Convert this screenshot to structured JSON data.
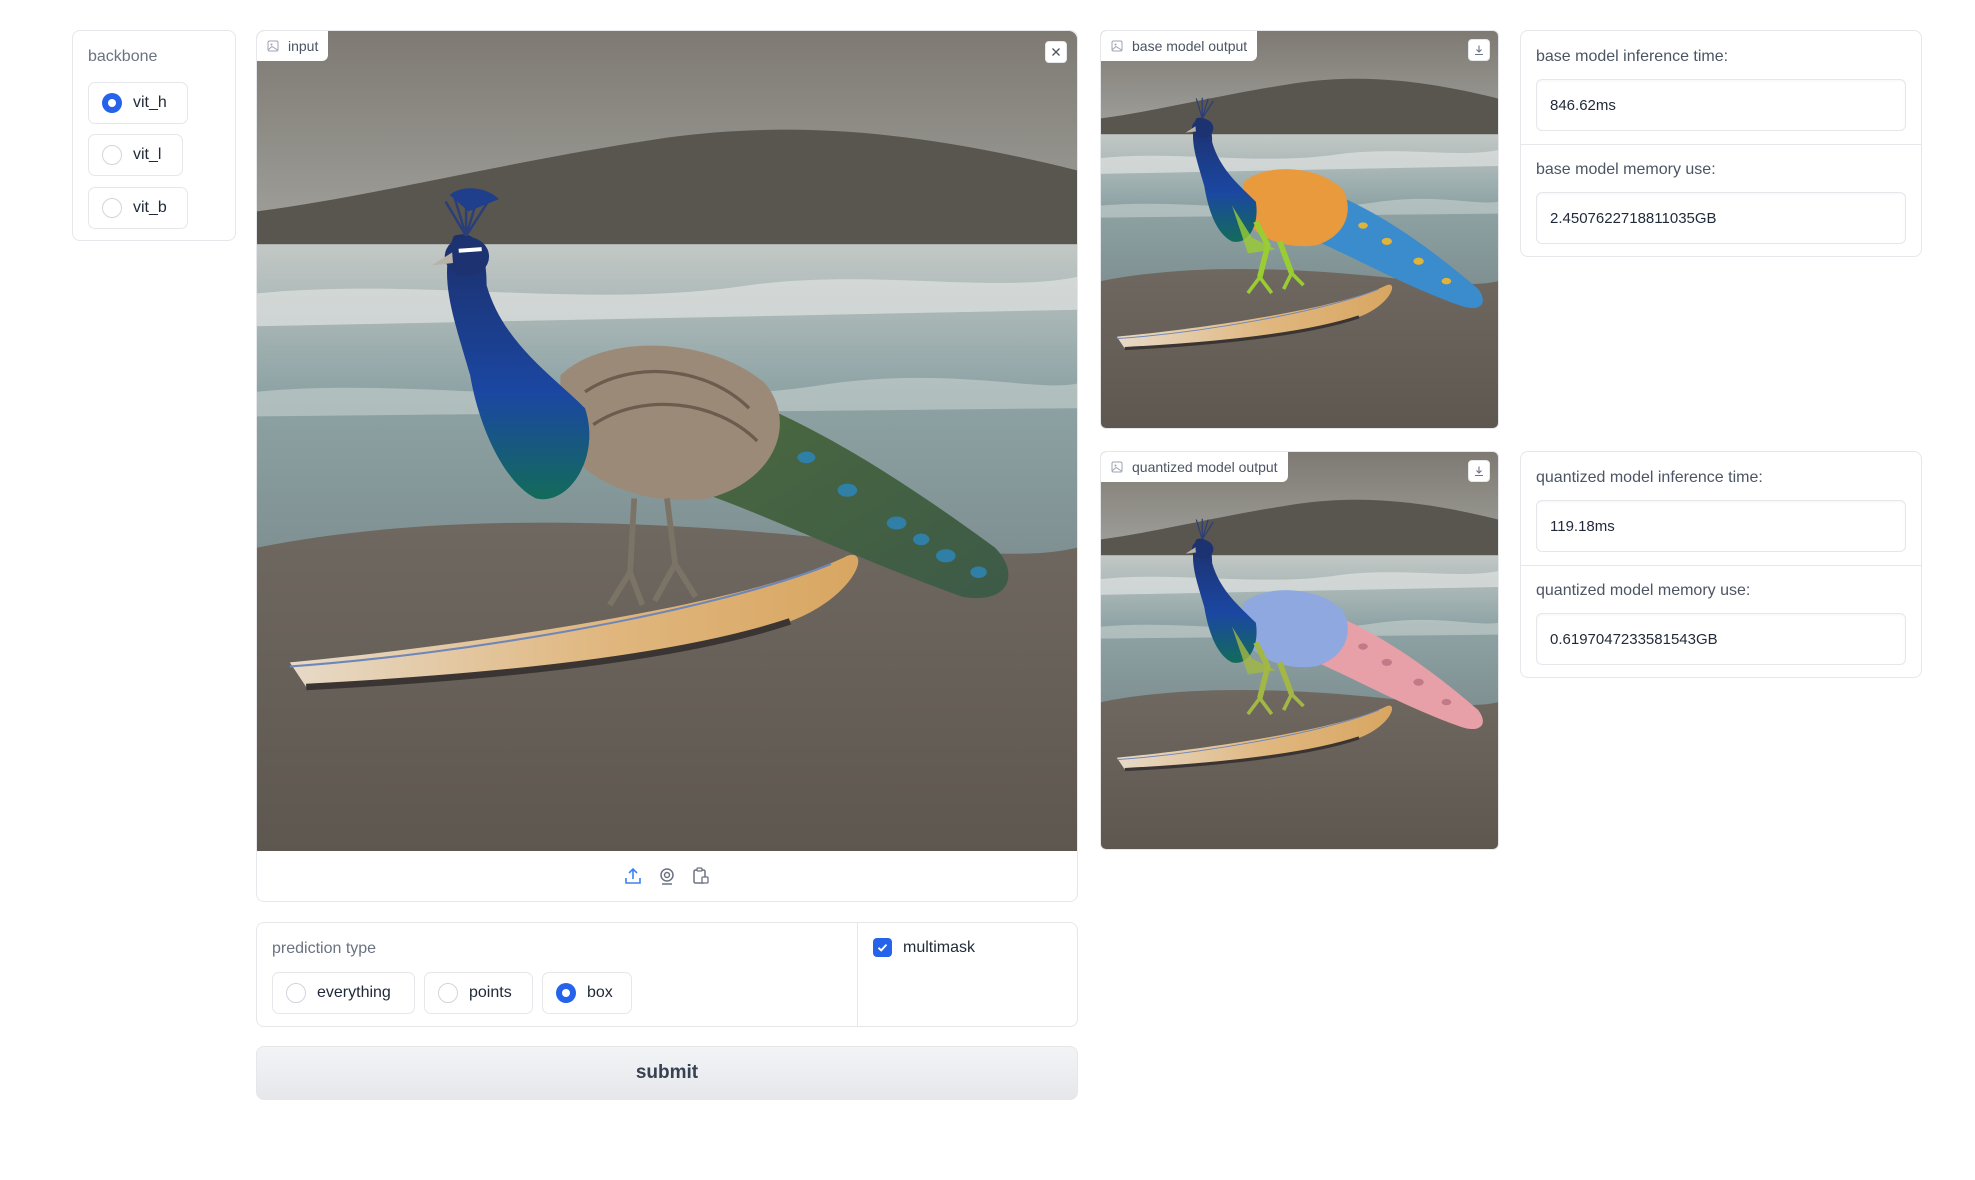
{
  "backbone": {
    "label": "backbone",
    "options": [
      {
        "label": "vit_h",
        "selected": true
      },
      {
        "label": "vit_l",
        "selected": false
      },
      {
        "label": "vit_b",
        "selected": false
      }
    ]
  },
  "input_image": {
    "label": "input",
    "close_icon": "close-icon",
    "toolbar_icons": [
      "upload-icon",
      "webcam-icon",
      "clipboard-icon"
    ]
  },
  "base_output": {
    "label": "base model output",
    "download_icon": "download-icon"
  },
  "quantized_output": {
    "label": "quantized model output",
    "download_icon": "download-icon"
  },
  "base_stats": {
    "time_label": "base model inference time:",
    "time_value": "846.62ms",
    "memory_label": "base model memory use:",
    "memory_value": "2.4507622718811035GB"
  },
  "quantized_stats": {
    "time_label": "quantized model inference time:",
    "time_value": "119.18ms",
    "memory_label": "quantized model memory use:",
    "memory_value": "0.6197047233581543GB"
  },
  "prediction_type": {
    "label": "prediction type",
    "options": [
      {
        "label": "everything",
        "selected": false
      },
      {
        "label": "points",
        "selected": false
      },
      {
        "label": "box",
        "selected": true
      }
    ]
  },
  "multimask": {
    "label": "multimask",
    "checked": true
  },
  "submit_label": "submit",
  "colors": {
    "accent": "#2563eb",
    "border": "#e5e7eb",
    "base_mask_body": "#e89a3c",
    "base_mask_tail": "#3b8ccc",
    "quant_mask_body": "#8fa8e0",
    "quant_mask_tail": "#e8a0a8",
    "mask_legs": "#9acd32"
  }
}
